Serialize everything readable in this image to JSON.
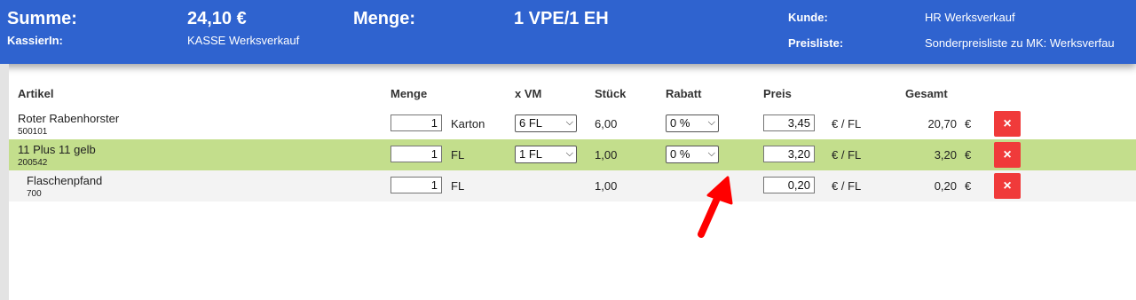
{
  "header": {
    "summe_label": "Summe:",
    "summe_value": "24,10 €",
    "menge_label": "Menge:",
    "menge_value": "1 VPE/1 EH",
    "kassierin_label": "KassierIn:",
    "kassierin_value": "KASSE Werksverkauf",
    "kunde_label": "Kunde:",
    "kunde_value": "HR Werksverkauf",
    "preisliste_label": "Preisliste:",
    "preisliste_value": "Sonderpreisliste zu MK: Werksverfau"
  },
  "table": {
    "columns": {
      "artikel": "Artikel",
      "menge": "Menge",
      "xvm": "x VM",
      "stueck": "Stück",
      "rabatt": "Rabatt",
      "preis": "Preis",
      "gesamt": "Gesamt"
    },
    "rows": [
      {
        "name": "Roter Rabenhorster",
        "code": "500101",
        "qty": "1",
        "unit": "Karton",
        "vm": "6 FL",
        "stueck": "6,00",
        "rabatt": "0 %",
        "preis": "3,45",
        "preis_unit": "€ / FL",
        "gesamt": "20,70",
        "currency": "€"
      },
      {
        "name": "11 Plus 11 gelb",
        "code": "200542",
        "qty": "1",
        "unit": "FL",
        "vm": "1 FL",
        "stueck": "1,00",
        "rabatt": "0 %",
        "preis": "3,20",
        "preis_unit": "€ / FL",
        "gesamt": "3,20",
        "currency": "€"
      },
      {
        "name": "Flaschenpfand",
        "code": "700",
        "qty": "1",
        "unit": "FL",
        "stueck": "1,00",
        "preis": "0,20",
        "preis_unit": "€ / FL",
        "gesamt": "0,20",
        "currency": "€"
      }
    ],
    "delete_icon": "×"
  },
  "colors": {
    "header_bg": "#2f63cf",
    "selected_row": "#c3de8c",
    "delete_button": "#f03a3a",
    "annotation_arrow": "#ff0000"
  },
  "icons": {
    "delete": "close-icon",
    "dropdown": "chevron-down-icon",
    "annotation": "arrow-annotation"
  }
}
